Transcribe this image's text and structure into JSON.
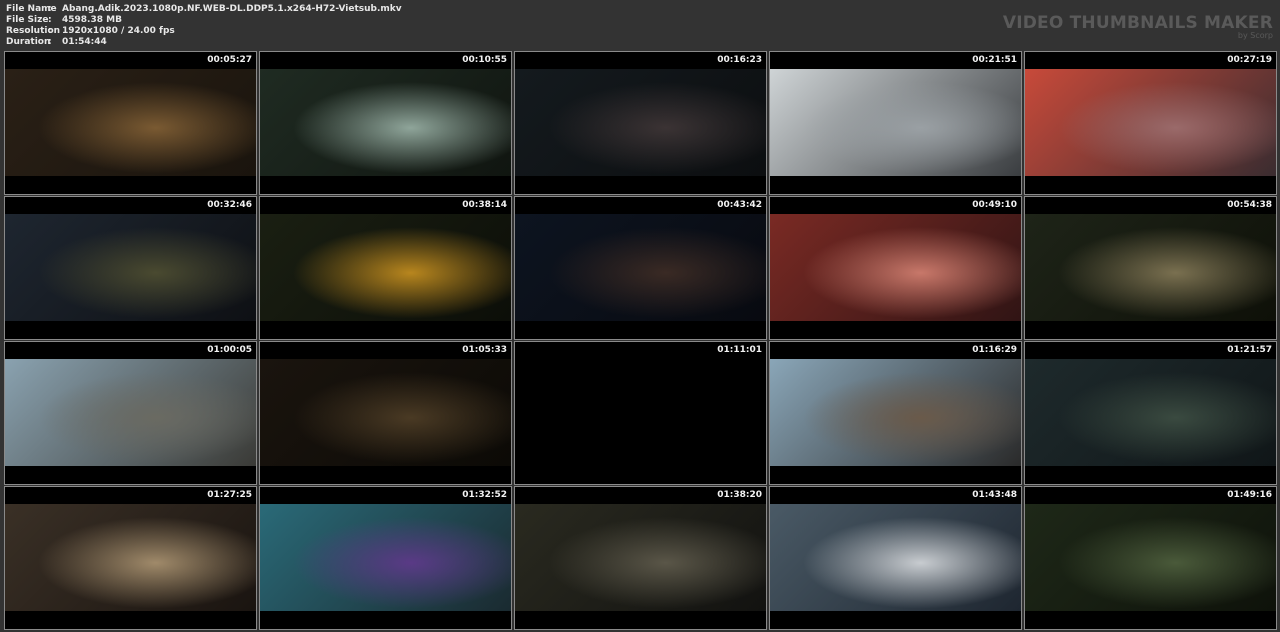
{
  "file_info": {
    "rows": [
      {
        "key": "File Name",
        "sep": ":",
        "value": "Abang.Adik.2023.1080p.NF.WEB-DL.DDP5.1.x264-H72-Vietsub.mkv"
      },
      {
        "key": "File Size",
        "sep": ":",
        "value": "4598.38 MB"
      },
      {
        "key": "Resolution",
        "sep": ":",
        "value": "1920x1080 / 24.00 fps"
      },
      {
        "key": "Duration",
        "sep": ":",
        "value": "01:54:44"
      }
    ]
  },
  "brand": {
    "title": "VIDEO THUMBNAILS MAKER",
    "subtitle": "by Scorp"
  },
  "thumbnails": [
    {
      "time": "00:05:27",
      "colors": [
        "#2a2016",
        "#7a5a32",
        "#1a140d"
      ]
    },
    {
      "time": "00:10:55",
      "colors": [
        "#1f2b22",
        "#8fa59a",
        "#101510"
      ]
    },
    {
      "time": "00:16:23",
      "colors": [
        "#141a1e",
        "#3b3334",
        "#0c0e10"
      ]
    },
    {
      "time": "00:21:51",
      "colors": [
        "#cfd4d6",
        "#9aa0a4",
        "#3a3d40"
      ]
    },
    {
      "time": "00:27:19",
      "colors": [
        "#c84a3a",
        "#9a6a6a",
        "#3a2c30"
      ]
    },
    {
      "time": "00:32:46",
      "colors": [
        "#1e2630",
        "#4a4a30",
        "#0e1014"
      ]
    },
    {
      "time": "00:38:14",
      "colors": [
        "#1a1f12",
        "#b8861e",
        "#0c0e08"
      ]
    },
    {
      "time": "00:43:42",
      "colors": [
        "#0d1420",
        "#3a2a24",
        "#080a10"
      ]
    },
    {
      "time": "00:49:10",
      "colors": [
        "#7a2a24",
        "#c8786a",
        "#301414"
      ]
    },
    {
      "time": "00:54:38",
      "colors": [
        "#1e2418",
        "#7a7050",
        "#0e1008"
      ]
    },
    {
      "time": "01:00:05",
      "colors": [
        "#8aa2b0",
        "#6a6a62",
        "#3a3a36"
      ]
    },
    {
      "time": "01:05:33",
      "colors": [
        "#1a140e",
        "#4a3a24",
        "#0c0a06"
      ]
    },
    {
      "time": "01:11:01",
      "colors": [
        "#000000",
        "#000000",
        "#000000"
      ]
    },
    {
      "time": "01:16:29",
      "colors": [
        "#8aa6b8",
        "#6a5a4a",
        "#2a2a2a"
      ]
    },
    {
      "time": "01:21:57",
      "colors": [
        "#1e2a2c",
        "#3a4a40",
        "#101618"
      ]
    },
    {
      "time": "01:27:25",
      "colors": [
        "#3a3026",
        "#a08a6a",
        "#1a1410"
      ]
    },
    {
      "time": "01:32:52",
      "colors": [
        "#2a6a78",
        "#5a3a86",
        "#1a2a30"
      ]
    },
    {
      "time": "01:38:20",
      "colors": [
        "#2a2a20",
        "#5a5648",
        "#121210"
      ]
    },
    {
      "time": "01:43:48",
      "colors": [
        "#4a5a66",
        "#c8ccd0",
        "#1e2630"
      ]
    },
    {
      "time": "01:49:16",
      "colors": [
        "#1e2818",
        "#4a5a3a",
        "#0e120a"
      ]
    }
  ]
}
